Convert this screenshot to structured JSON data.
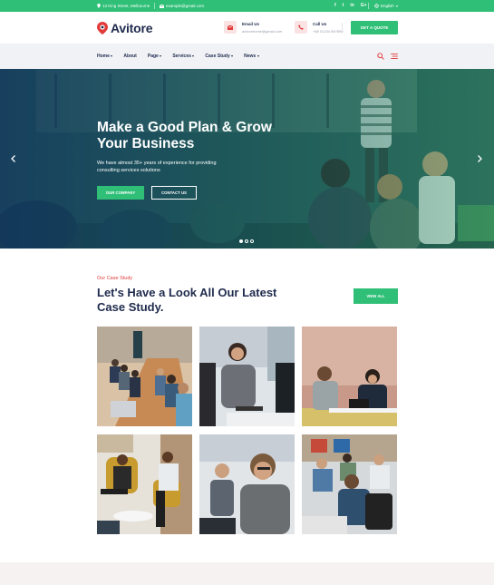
{
  "topbar": {
    "address": "13 King Street, Melbourne",
    "email": "example@gmail.com",
    "socials": [
      "f",
      "t",
      "in",
      "G+"
    ],
    "language": "English"
  },
  "header": {
    "brand": "Avitore",
    "email_label": "Email Us",
    "email_value": "avitorehome@gmail.com",
    "call_label": "Call Us",
    "call_value": "+88 01234 567890",
    "quote_button": "GET A QUOTE"
  },
  "nav": {
    "items": [
      {
        "label": "Home",
        "dropdown": true
      },
      {
        "label": "About",
        "dropdown": false
      },
      {
        "label": "Page",
        "dropdown": true
      },
      {
        "label": "Services",
        "dropdown": true
      },
      {
        "label": "Case Study",
        "dropdown": true
      },
      {
        "label": "News",
        "dropdown": true
      }
    ]
  },
  "hero": {
    "title": "Make a Good Plan & Grow Your Business",
    "text": "We have almost 35+ years of experience for providing consulting services solutions",
    "primary_button": "OUR COMPANY",
    "secondary_button": "CONTACT US"
  },
  "case_study": {
    "eyebrow": "Our Case Study",
    "title": "Let's Have a Look All Our Latest Case Study.",
    "view_button": "VIEW ALL"
  },
  "colors": {
    "accent": "#2fbf76",
    "heading": "#1f2b4d",
    "eyebrow": "#e23b3b",
    "nav_bg": "#f1f2f6"
  }
}
